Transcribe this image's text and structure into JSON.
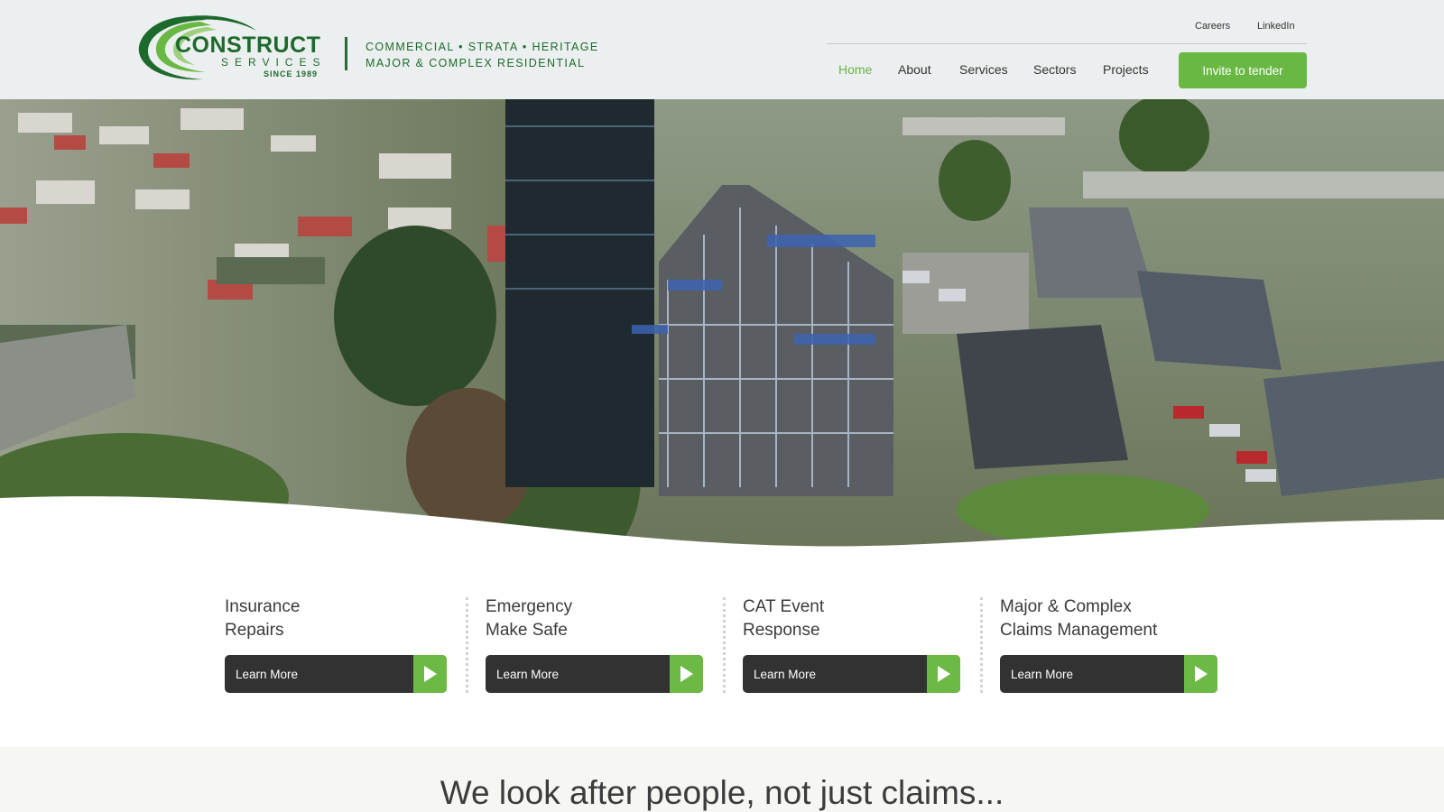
{
  "brand": {
    "name": "CONSTRUCT",
    "sub": "SERVICES",
    "since": "SINCE 1989",
    "tagline_line1": "COMMERCIAL • STRATA • HERITAGE",
    "tagline_line2": "MAJOR & COMPLEX RESIDENTIAL",
    "color_green": "#1d6a2d",
    "color_accent": "#69b843"
  },
  "utility_nav": {
    "careers": "Careers",
    "linkedin": "LinkedIn"
  },
  "main_nav": {
    "items": [
      "Home",
      "About",
      "Services",
      "Sectors",
      "Projects"
    ],
    "active": "Home",
    "cta": "Invite to tender"
  },
  "services": [
    {
      "line1": "Insurance",
      "line2": "Repairs",
      "button": "Learn More"
    },
    {
      "line1": "Emergency",
      "line2": "Make Safe",
      "button": "Learn More"
    },
    {
      "line1": "CAT Event",
      "line2": "Response",
      "button": "Learn More"
    },
    {
      "line1": "Major & Complex",
      "line2": "Claims Management",
      "button": "Learn More"
    }
  ],
  "headline": "We look after people, not just claims..."
}
